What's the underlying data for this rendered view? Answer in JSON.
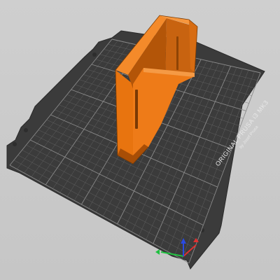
{
  "app": {
    "view": "3D Plater"
  },
  "bed": {
    "brand_line": "ORIGINAL PRUSA i3 MK3",
    "byline": "by Josef Prusa",
    "color": "#3a3a3a",
    "grid_color": "#6a6a6a",
    "grid_major_color": "#8a8a8a"
  },
  "model": {
    "color": "#f07d1a",
    "shade_color": "#c85f0b",
    "dark_color": "#9a4a08"
  },
  "axes": {
    "x_color": "#e03030",
    "y_color": "#20c040",
    "z_color": "#2a4ae0"
  }
}
